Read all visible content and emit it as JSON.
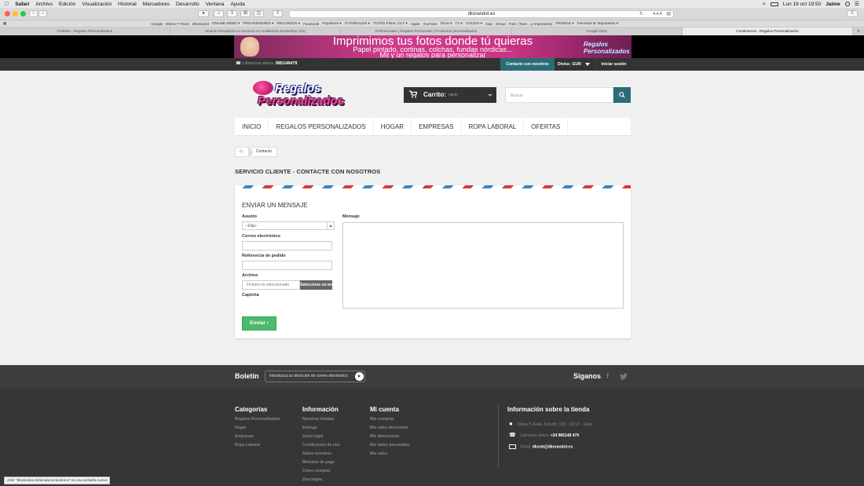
{
  "os_menubar": {
    "app": "Safari",
    "items": [
      "Archivo",
      "Edición",
      "Visualización",
      "Historial",
      "Marcadores",
      "Desarrollo",
      "Ventana",
      "Ayuda"
    ],
    "datetime": "Lun 19 oct  19:50",
    "user": "Jaime"
  },
  "browser": {
    "url": "dkorandot.es",
    "reader_label": "A A A",
    "bookmarks": [
      "Google",
      "Dkora-T Panel",
      "Dkorandot",
      "ONLINE WEBS ▾",
      "PROVEEDORES ▾",
      "RECURSOS ▾",
      "Facebook",
      "Populares ▾",
      "TUTORIALES ▾",
      "TUTOS FINAL CUT ▾",
      "Apple",
      "YouTube",
      "fonos ▾",
      "TV ▾",
      "COCINA ▾",
      "max",
      "iCloud",
      "Foto: (Todo ...y Importante)",
      "TIENDAS ▾",
      "Favoritos IE Importados ▾"
    ],
    "tabs": [
      {
        "label": "Pedidos › Regalos Personalizados",
        "active": false
      },
      {
        "label": "Modulo Recaptcha no funciona en multitienda prestashop (1/1)",
        "active": false
      },
      {
        "label": "Profesionales | Regalos Personales | Productos personalizados",
        "active": false
      },
      {
        "label": "Google Drive",
        "active": false
      },
      {
        "label": "Contáctenos - Regalos Personalizados",
        "active": true
      }
    ],
    "status_text": "Abrir \"dkorandot.es/tienda/contactenos\" en una pestaña nueva"
  },
  "banner": {
    "line1": "Imprimimos tus fotos donde tú quieras",
    "line2": "Papel pintado, cortinas, colchas, fundas nórdicas...",
    "line3": "Mil y un regalos para personalizar",
    "logo_text": "Regalos Personalizados"
  },
  "nav": {
    "phone_label": "Llámenos ahora:",
    "phone_number": "985148479",
    "contact_button": "Contacte con nosotros",
    "currency": "Divisa : EUR",
    "login": "Iniciar sesión"
  },
  "logo": {
    "line1": "Regalos",
    "line2": "Personalizados"
  },
  "cart": {
    "label": "Carrito:",
    "value": "vacío"
  },
  "search": {
    "placeholder": "Buscar"
  },
  "menu": [
    "INICIO",
    "REGALOS PERSONALIZADOS",
    "HOGAR",
    "EMPRESAS",
    "ROPA LABORAL",
    "OFERTAS"
  ],
  "breadcrumb": {
    "current": "Contacto"
  },
  "page": {
    "title": "SERVICIO CLIENTE - CONTACTE CON NOSOTROS"
  },
  "form": {
    "title": "ENVIAR UN MENSAJE",
    "subject_label": "Asunto",
    "subject_value": "--Elija--",
    "email_label": "Correo electrónico",
    "order_label": "Referencia de pedido",
    "file_label": "Archivo",
    "file_placeholder": "Fichero no seleccionado",
    "file_button": "Seleccione un archivo",
    "captcha_label": "Captcha",
    "message_label": "Mensaje",
    "send_button": "Enviar"
  },
  "newsletter": {
    "title": "Boletín",
    "placeholder": "Introduzca su dirección de correo electrónico",
    "follow": "Síganos"
  },
  "footer": {
    "categories": {
      "title": "Categorías",
      "links": [
        "Regalos Personalizados",
        "Hogar",
        "Empresas",
        "Ropa Laboral"
      ]
    },
    "info": {
      "title": "Información",
      "links": [
        "Nuestras tiendas",
        "Entrega",
        "Aviso legal",
        "Condiciones de uso",
        "Sobre nosotros",
        "Metodos de pago",
        "Cómo comprar",
        "Descargas"
      ]
    },
    "account": {
      "title": "Mi cuenta",
      "links": [
        "Mis compras",
        "Mis vales descuento",
        "Mis direcciones",
        "Mis datos personales",
        "Mis vales"
      ]
    },
    "store": {
      "title": "Información sobre la tienda",
      "address": "Dkora-T, Avda. Schultz, 135 · 33210 · Gijón",
      "phone_label": "Llámenos ahora:",
      "phone_number": "+34 985148 479",
      "email_label": "Email:",
      "email": "dkorat@dkorandot.es"
    }
  },
  "colors": {
    "accent": "#2a6d77",
    "send": "#4cbb6c",
    "dark": "#333333"
  }
}
